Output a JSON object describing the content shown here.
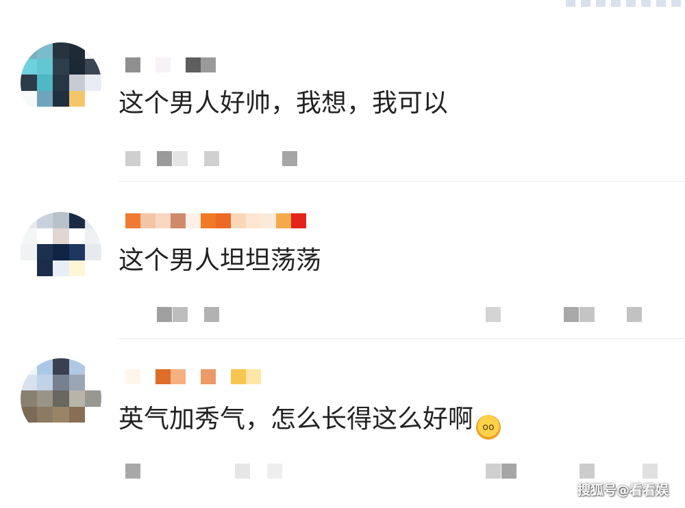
{
  "comments": [
    {
      "text": "这个男人好帅，我想，我可以"
    },
    {
      "text": "这个男人坦坦荡荡"
    },
    {
      "text": "英气加秀气，怎么长得这么好啊"
    }
  ],
  "emoji": {
    "icon": "scream-face-emoji",
    "glyph": "oo"
  },
  "watermark": "搜狐号@看看娱"
}
